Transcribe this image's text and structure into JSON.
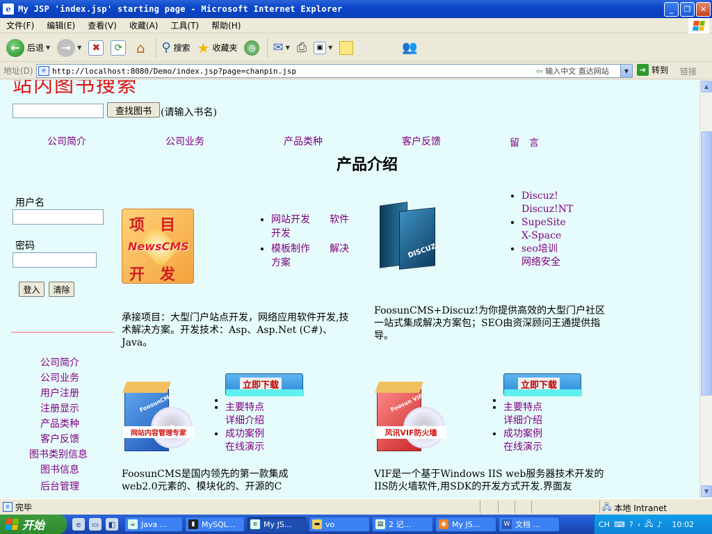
{
  "window": {
    "title": "My JSP 'index.jsp' starting page - Microsoft Internet Explorer"
  },
  "menu": [
    "文件(F)",
    "编辑(E)",
    "查看(V)",
    "收藏(A)",
    "工具(T)",
    "帮助(H)"
  ],
  "toolbar": {
    "back": "后退",
    "search": "搜索",
    "favorites": "收藏夹"
  },
  "address": {
    "label": "地址(D)",
    "url": "http://localhost:8080/Demo/index.jsp?page=chanpin.jsp",
    "hint": "输入中文 直达网站",
    "go": "转到",
    "links": "链接"
  },
  "page": {
    "search_title": "站内图书搜索",
    "search_button": "查找图书",
    "search_hint": "(请输入书名)",
    "nav": [
      "公司简介",
      "公司业务",
      "产品类种",
      "客户反馈",
      "留　言"
    ],
    "heading": "产品介绍",
    "login": {
      "user_label": "用户名",
      "pass_label": "密码",
      "login_button": "登入",
      "clear_button": "清除"
    },
    "side_links": [
      "公司简介",
      "公司业务",
      "用户注册",
      "注册显示",
      "产品类种",
      "客户反馈",
      "图书类别信息",
      "图书信息",
      "后台管理"
    ],
    "logo1": {
      "line1": "项　目",
      "mid": "NewsCMS",
      "line2": "开　发"
    },
    "list1": [
      "网站开发　　软件开发",
      "模板制作　　解决方案"
    ],
    "box_logo": "DISCUZ!",
    "list2": [
      {
        "a": "Discuz!",
        "b": "Discuz!NT"
      },
      {
        "a": "SupeSite",
        "b": "X-Space"
      },
      {
        "a": " seo培训",
        "b": "网络安全"
      }
    ],
    "desc1": "承接项目：大型门户站点开发，网络应用软件开发,技术解决方案。开发技术：Asp、Asp.Net (C#)、Java。",
    "desc2": "FoosunCMS+Discuz!为你提供高效的大型门户社区一站式集成解决方案包；SEO由资深顾问王通提供指导。",
    "download": "立即下载",
    "box1_label": "网站内容管理专家",
    "box1_brand": "FoosunCMS",
    "box2_label": "风讯VIF防火墙",
    "box2_brand": "Foosun VIF",
    "list3": [
      "主要特点",
      "详细介绍",
      "成功案例",
      "在线演示"
    ],
    "list4": [
      "主要特点",
      "详细介绍",
      "成功案例",
      "在线演示"
    ],
    "desc3": "FoosunCMS是国内领先的第一款集成web2.0元素的、模块化的、开源的C",
    "desc4": "VIF是一个基于Windows IIS web服务器技术开发的IIS防火墙软件,用SDK的开发方式开发.界面友"
  },
  "status": {
    "done": "完毕",
    "zone": "本地 Intranet"
  },
  "taskbar": {
    "start": "开始",
    "tasks": [
      "Java ...",
      "MySQL...",
      "My JS...",
      "vo",
      "2 记...",
      "My JS...",
      "文档 ..."
    ],
    "lang": "CH",
    "clock": "10:02"
  },
  "colors": {
    "content_bg": "#e6fbfb",
    "title_red": "#e01010",
    "link": "#800080"
  }
}
